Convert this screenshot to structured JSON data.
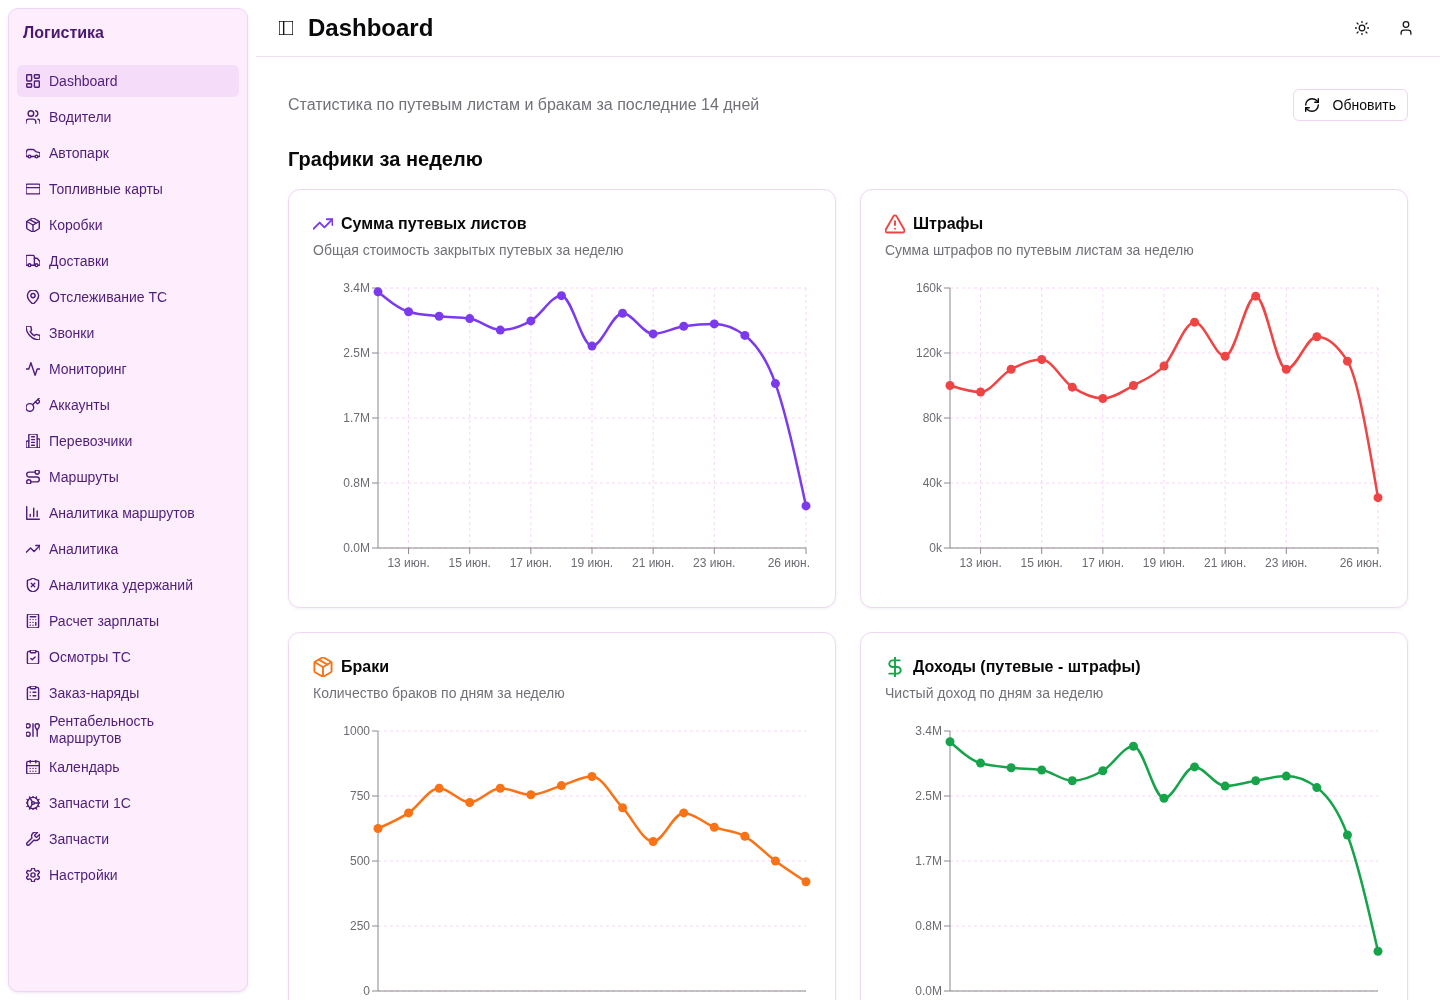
{
  "sidebar": {
    "title": "Логистика",
    "items": [
      {
        "label": "Dashboard",
        "selected": true
      },
      {
        "label": "Водители",
        "selected": false
      },
      {
        "label": "Автопарк",
        "selected": false
      },
      {
        "label": "Топливные карты",
        "selected": false
      },
      {
        "label": "Коробки",
        "selected": false
      },
      {
        "label": "Доставки",
        "selected": false
      },
      {
        "label": "Отслеживание ТС",
        "selected": false
      },
      {
        "label": "Звонки",
        "selected": false
      },
      {
        "label": "Мониторинг",
        "selected": false
      },
      {
        "label": "Аккаунты",
        "selected": false
      },
      {
        "label": "Перевозчики",
        "selected": false
      },
      {
        "label": "Маршруты",
        "selected": false
      },
      {
        "label": "Аналитика маршрутов",
        "selected": false
      },
      {
        "label": "Аналитика",
        "selected": false
      },
      {
        "label": "Аналитика удержаний",
        "selected": false
      },
      {
        "label": "Расчет зарплаты",
        "selected": false
      },
      {
        "label": "Осмотры ТС",
        "selected": false
      },
      {
        "label": "Заказ-наряды",
        "selected": false
      },
      {
        "label": "Рентабельность маршрутов",
        "selected": false
      },
      {
        "label": "Календарь",
        "selected": false
      },
      {
        "label": "Запчасти 1С",
        "selected": false
      },
      {
        "label": "Запчасти",
        "selected": false
      },
      {
        "label": "Настройки",
        "selected": false
      }
    ]
  },
  "header": {
    "title": "Dashboard"
  },
  "content": {
    "subtitle": "Статистика по путевым листам и бракам за последние 14 дней",
    "refresh_button": "Обновить",
    "section_title": "Графики за неделю"
  },
  "charts": [
    {
      "title": "Сумма путевых листов",
      "description": "Общая стоимость закрытых путевых за неделю",
      "chart_data": {
        "type": "line",
        "x": [
          12,
          13,
          14,
          15,
          16,
          17,
          18,
          19,
          20,
          21,
          22,
          23,
          24,
          25,
          26
        ],
        "series": [
          {
            "color": "#7c3aed",
            "marker": "circle",
            "values": [
              3350000,
              3090000,
              3030000,
              3000000,
              2850000,
              2970000,
              3300000,
              2640000,
              3070000,
              2800000,
              2900000,
              2930000,
              2780000,
              2150000,
              550000
            ]
          }
        ],
        "xlim": [
          12,
          26
        ],
        "ylim": [
          0,
          3400000
        ],
        "grid": true,
        "xticks": [
          {
            "value": 13,
            "label": "13 июн."
          },
          {
            "value": 15,
            "label": "15 июн."
          },
          {
            "value": 17,
            "label": "17 июн."
          },
          {
            "value": 19,
            "label": "19 июн."
          },
          {
            "value": 21,
            "label": "21 июн."
          },
          {
            "value": 23,
            "label": "23 июн."
          },
          {
            "value": 26,
            "label": "26 июн."
          }
        ],
        "yticks": [
          {
            "value": 0,
            "label": "0.0M"
          },
          {
            "value": 850000,
            "label": "0.8M"
          },
          {
            "value": 1700000,
            "label": "1.7M"
          },
          {
            "value": 2550000,
            "label": "2.5M"
          },
          {
            "value": 3400000,
            "label": "3.4M"
          }
        ]
      }
    },
    {
      "title": "Штрафы",
      "description": "Сумма штрафов по путевым листам за неделю",
      "chart_data": {
        "type": "line",
        "x": [
          12,
          13,
          14,
          15,
          16,
          17,
          18,
          19,
          20,
          21,
          22,
          23,
          24,
          25,
          26
        ],
        "series": [
          {
            "color": "#ef4444",
            "marker": "circle",
            "values": [
              100000,
              96000,
              110000,
              116000,
              99000,
              92000,
              100000,
              112000,
              139000,
              118000,
              155000,
              110000,
              130000,
              115000,
              31000
            ]
          }
        ],
        "xlim": [
          12,
          26
        ],
        "ylim": [
          0,
          160000
        ],
        "grid": true,
        "xticks": [
          {
            "value": 13,
            "label": "13 июн."
          },
          {
            "value": 15,
            "label": "15 июн."
          },
          {
            "value": 17,
            "label": "17 июн."
          },
          {
            "value": 19,
            "label": "19 июн."
          },
          {
            "value": 21,
            "label": "21 июн."
          },
          {
            "value": 23,
            "label": "23 июн."
          },
          {
            "value": 26,
            "label": "26 июн."
          }
        ],
        "yticks": [
          {
            "value": 0,
            "label": "0k"
          },
          {
            "value": 40000,
            "label": "40k"
          },
          {
            "value": 80000,
            "label": "80k"
          },
          {
            "value": 120000,
            "label": "120k"
          },
          {
            "value": 160000,
            "label": "160k"
          }
        ]
      }
    },
    {
      "title": "Браки",
      "description": "Количество браков по дням за неделю",
      "chart_data": {
        "type": "line",
        "x": [
          12,
          13,
          14,
          15,
          16,
          17,
          18,
          19,
          20,
          21,
          22,
          23,
          24,
          25,
          26
        ],
        "series": [
          {
            "color": "#f97316",
            "marker": "circle",
            "values": [
              625,
              685,
              780,
              725,
              780,
              755,
              790,
              825,
              705,
              575,
              685,
              630,
              595,
              500,
              420
            ]
          }
        ],
        "xlim": [
          12,
          26
        ],
        "ylim": [
          0,
          1000
        ],
        "grid": true,
        "yticks": [
          {
            "value": 0,
            "label": "0"
          },
          {
            "value": 250,
            "label": "250"
          },
          {
            "value": 500,
            "label": "500"
          },
          {
            "value": 750,
            "label": "750"
          },
          {
            "value": 1000,
            "label": "1000"
          }
        ]
      }
    },
    {
      "title": "Доходы (путевые - штрафы)",
      "description": "Чистый доход по дням за неделю",
      "chart_data": {
        "type": "line",
        "x": [
          12,
          13,
          14,
          15,
          16,
          17,
          18,
          19,
          20,
          21,
          22,
          23,
          24,
          25,
          26
        ],
        "series": [
          {
            "color": "#16a34a",
            "marker": "circle",
            "values": [
              3260000,
              2980000,
              2920000,
              2890000,
              2750000,
              2880000,
              3200000,
              2520000,
              2930000,
              2680000,
              2750000,
              2810000,
              2660000,
              2040000,
              520000
            ]
          }
        ],
        "xlim": [
          12,
          26
        ],
        "ylim": [
          0,
          3400000
        ],
        "grid": true,
        "yticks": [
          {
            "value": 0,
            "label": "0.0M"
          },
          {
            "value": 850000,
            "label": "0.8M"
          },
          {
            "value": 1700000,
            "label": "1.7M"
          },
          {
            "value": 2550000,
            "label": "2.5M"
          },
          {
            "value": 3400000,
            "label": "3.4M"
          }
        ]
      }
    }
  ]
}
